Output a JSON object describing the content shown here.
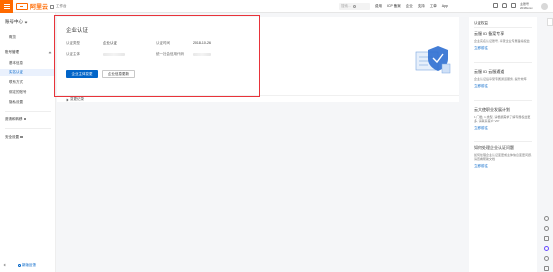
{
  "topbar": {
    "logo_text": "阿里云",
    "workspace_label": "工作台",
    "search_placeholder": "搜索...",
    "nav": [
      "费用",
      "ICP 备案",
      "企业",
      "支持",
      "工单",
      "App"
    ],
    "account_line1": "主账号",
    "account_line2": "2018xxxx"
  },
  "sidebar": {
    "title": "账号中心",
    "items": [
      {
        "label": "概览"
      },
      {
        "group": "账号管理"
      },
      {
        "label": "基本信息"
      },
      {
        "label": "实名认证",
        "active": true
      },
      {
        "label": "联系方式"
      },
      {
        "label": "绑定的账号"
      },
      {
        "label": "隐私设置"
      },
      {
        "label": "邀请和转移"
      },
      {
        "label": "安全设置"
      }
    ],
    "feedback_label": "新版反馈"
  },
  "main": {
    "card_title": "企业认证",
    "fields": [
      {
        "key": "认证类型",
        "value": "企业认证"
      },
      {
        "key": "认证时间",
        "value": "2018-10-26"
      },
      {
        "key": "认证主体",
        "value": ""
      },
      {
        "key": "统一社会信用代码",
        "value": ""
      }
    ],
    "primary_button": "企业主体变更",
    "secondary_button": "企业信息更新",
    "collapse_label": "变更记录"
  },
  "right_panel": {
    "title": "认证权益",
    "blocks": [
      {
        "heading": "云服 ID 备案专享",
        "desc": "企业实名认证账号, 享受企业专属备案权益",
        "link": "立即前往"
      },
      {
        "heading": "云服 ID 云服通道",
        "desc": "企业认证后享受专属通道服务, 提升效率",
        "link": "立即前往"
      },
      {
        "heading": "云大使职业发展计划",
        "desc": "1 门槛, 1 类型, 请根据需求了解专属权益更多, 请联系客户 VIP",
        "link": "立即前往"
      },
      {
        "heading": "如何处理企业认证问题",
        "desc": "如何处理企业认证变更或主体信息变更问题, 请查看帮助文档",
        "link": "立即前往"
      }
    ]
  },
  "colors": {
    "brand": "#ff6a00",
    "primary": "#0064c8",
    "highlight": "#e8333a"
  }
}
